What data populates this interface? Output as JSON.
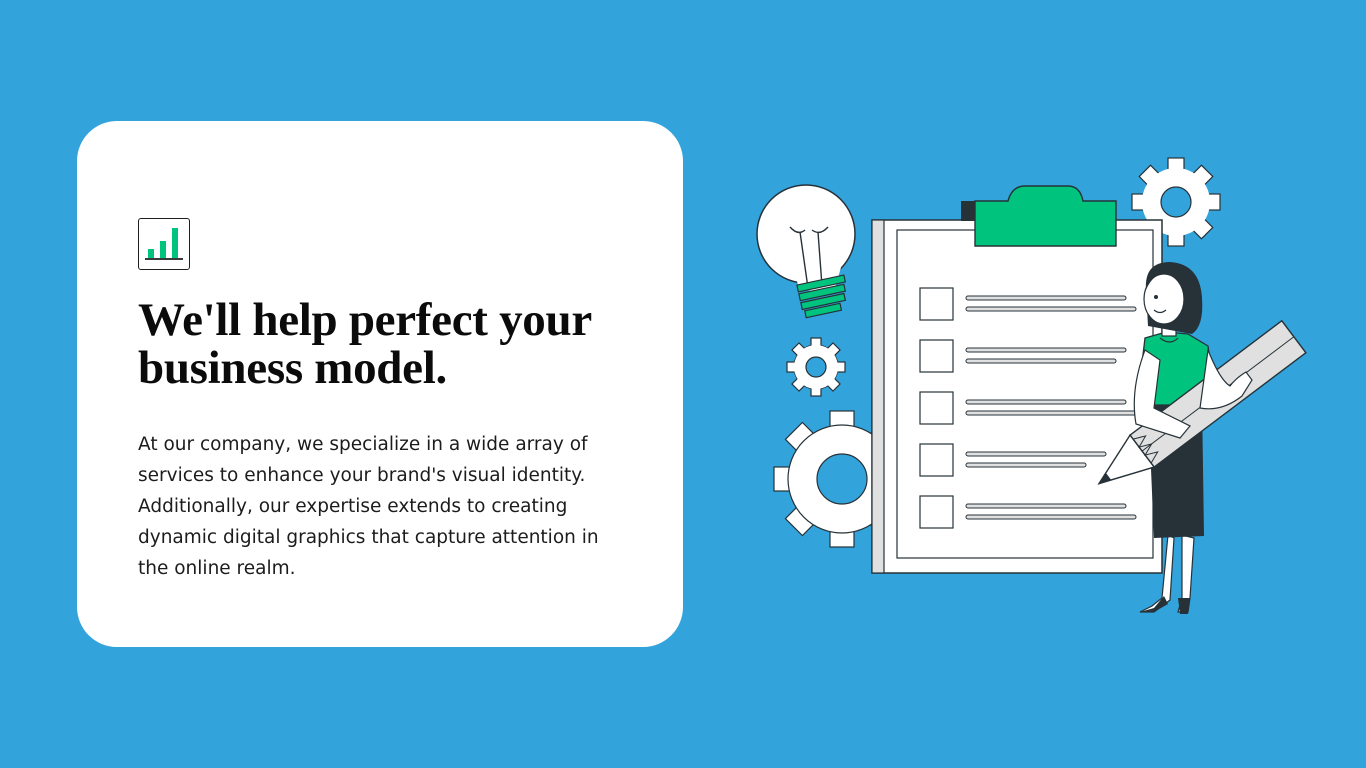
{
  "card": {
    "icon": "bar-chart-icon",
    "headline": "We'll help perfect your business model.",
    "body": "At our company, we specialize in a wide array of services to enhance your brand's visual identity. Additionally, our expertise extends to creating dynamic digital graphics that capture attention in the online realm."
  },
  "illustration": {
    "icons": [
      "lightbulb-icon",
      "gear-icon",
      "clipboard-checklist",
      "pencil-icon",
      "woman-figure"
    ],
    "checklist_items": 5
  },
  "colors": {
    "background": "#33a3dc",
    "card": "#ffffff",
    "accent": "#00c47d",
    "ink": "#263238"
  }
}
